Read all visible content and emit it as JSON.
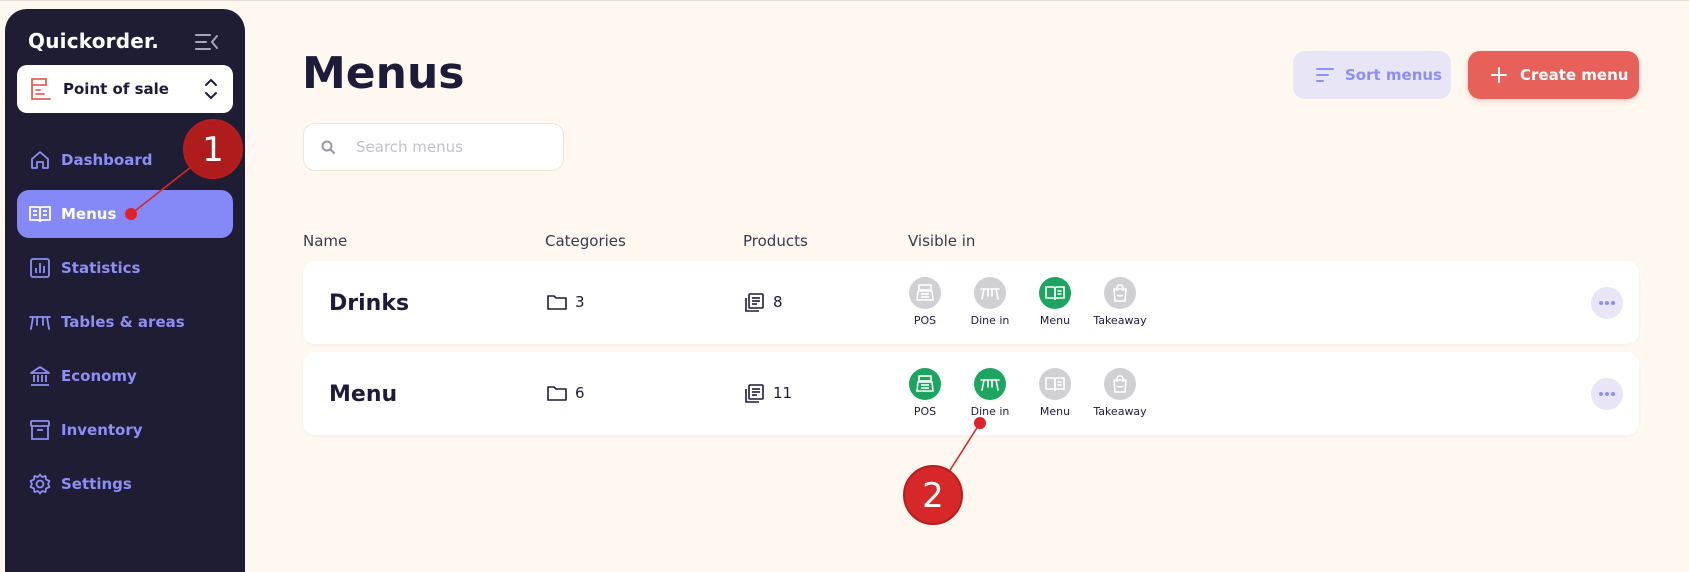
{
  "app": {
    "brand": "Quickorder."
  },
  "location_select": {
    "label": "Point of sale"
  },
  "nav": {
    "items": [
      {
        "label": "Dashboard",
        "icon": "home-icon"
      },
      {
        "label": "Menus",
        "icon": "book-icon",
        "active": true
      },
      {
        "label": "Statistics",
        "icon": "chart-icon"
      },
      {
        "label": "Tables & areas",
        "icon": "table-icon"
      },
      {
        "label": "Economy",
        "icon": "bank-icon"
      },
      {
        "label": "Inventory",
        "icon": "archive-icon"
      },
      {
        "label": "Settings",
        "icon": "gear-icon"
      }
    ]
  },
  "page": {
    "title": "Menus",
    "sort_label": "Sort menus",
    "create_label": "Create menu"
  },
  "search": {
    "placeholder": "Search menus",
    "value": ""
  },
  "table": {
    "headers": {
      "name": "Name",
      "categories": "Categories",
      "products": "Products",
      "visible_in": "Visible in"
    },
    "channel_labels": [
      "POS",
      "Dine in",
      "Menu",
      "Takeaway"
    ],
    "rows": [
      {
        "name": "Drinks",
        "categories": "3",
        "products": "8",
        "visible": [
          false,
          false,
          true,
          false
        ]
      },
      {
        "name": "Menu",
        "categories": "6",
        "products": "11",
        "visible": [
          true,
          true,
          false,
          false
        ]
      }
    ]
  },
  "annotations": {
    "badge1": "1",
    "badge2": "2"
  },
  "colors": {
    "sidebar_bg": "#1e1d33",
    "accent": "#8589f8",
    "create": "#e8605a",
    "enabled": "#1ca55e",
    "disabled": "#d0cfd3",
    "annotation": "#d62828"
  }
}
